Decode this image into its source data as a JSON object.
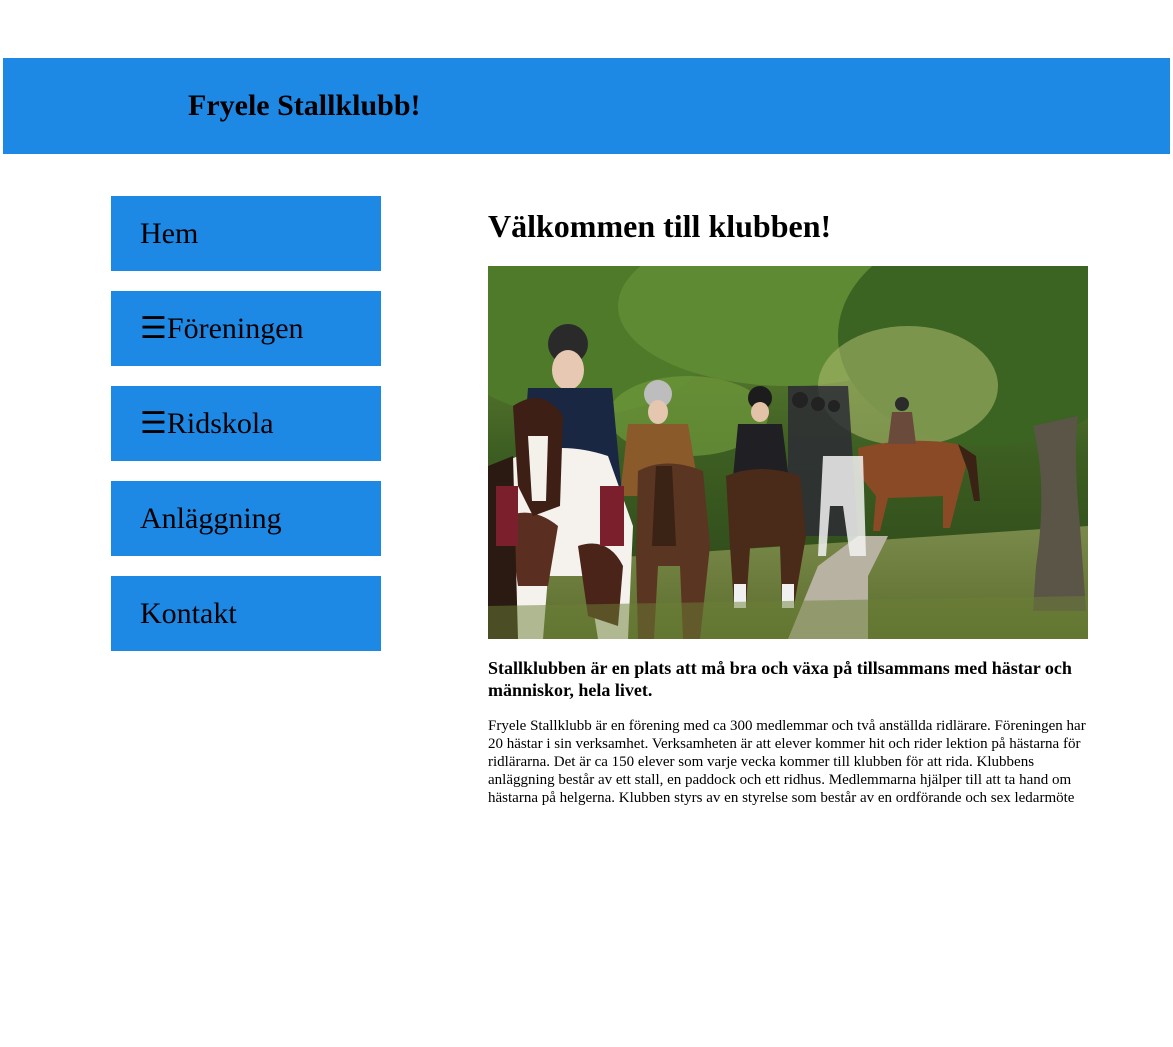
{
  "header": {
    "title": "Fryele Stallklubb!"
  },
  "nav": {
    "items": [
      {
        "label": "Hem"
      },
      {
        "label": "☰Föreningen"
      },
      {
        "label": "☰Ridskola"
      },
      {
        "label": "Anläggning"
      },
      {
        "label": "Kontakt"
      }
    ]
  },
  "main": {
    "heading": "Välkommen till klubben!",
    "lead": "Stallklubben är en plats att må bra och växa på tillsammans med hästar och människor, hela livet.",
    "body": "Fryele Stallklubb är en förening med ca 300 medlemmar och två anställda ridlärare. Föreningen har 20 hästar i sin verksamhet. Verksamheten är att elever kommer hit och rider lektion på hästarna för ridlärarna. Det är ca 150 elever som varje vecka kommer till klubben för att rida. Klubbens anläggning består av ett stall, en paddock och ett ridhus. Medlemmarna hjälper till att ta hand om hästarna på helgerna. Klubben styrs av en styrelse som består av en ordförande och sex ledarmöte"
  },
  "colors": {
    "accent": "#1e88e5",
    "background": "#ffffff",
    "text": "#000000"
  }
}
